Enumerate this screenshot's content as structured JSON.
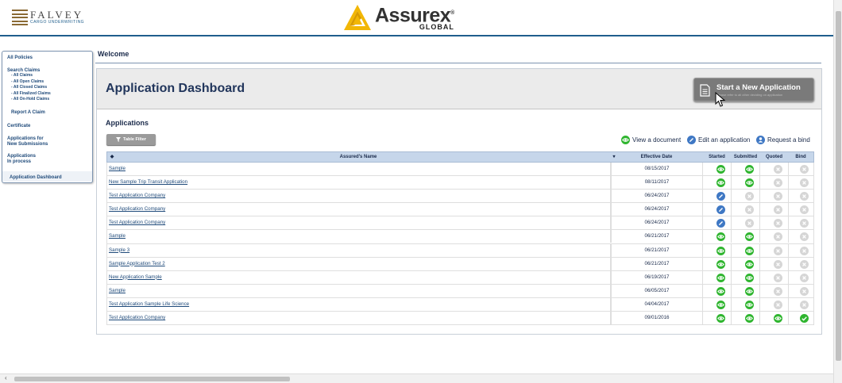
{
  "header": {
    "falvey_name": "FALVEY",
    "falvey_sub": "CARGO UNDERWRITING",
    "assurex_name": "Assurex",
    "assurex_reg": "®",
    "assurex_sub": "GLOBAL"
  },
  "sidebar": {
    "all_policies": "All Policies",
    "search_claims": "Search Claims",
    "claims": [
      "- All Claims",
      "- All Open Claims",
      "- All Closed Claims",
      "- All Finalized Claims",
      "- All On-Hold Claims"
    ],
    "report_claim": "Report A Claim",
    "certificate": "Certificate",
    "applications_new_1": "Applications for",
    "applications_new_2": "New Submissions",
    "applications_process_1": "Applications",
    "applications_process_2": "In process",
    "application_dashboard": "Application Dashboard"
  },
  "main": {
    "welcome": "Welcome",
    "dashboard_title": "Application Dashboard",
    "new_app_label": "Start a New Application",
    "new_app_sub": "Please refer to all other deciding on application",
    "applications_title": "Applications",
    "filter_label": "Table Filter",
    "legend": {
      "view": "View a document",
      "edit": "Edit an application",
      "request": "Request a bind"
    }
  },
  "colors": {
    "green": "#2fb52f",
    "blue": "#3f78c4",
    "gray": "#d6d6d6",
    "header_blue": "#c6d6ea",
    "accent": "#1f5e8c"
  },
  "table": {
    "columns": {
      "sort": "◆",
      "name": "Assured's Name",
      "sort2": "▾",
      "date": "Effective Date",
      "started": "Started",
      "submitted": "Submitted",
      "quoted": "Quoted",
      "bind": "Bind"
    },
    "rows": [
      {
        "name": "Sample",
        "date": "08/15/2017",
        "status": [
          "view",
          "view",
          "none",
          "none"
        ]
      },
      {
        "name": "New Sample Trip Transit Application",
        "date": "08/11/2017",
        "status": [
          "view",
          "view",
          "none",
          "none"
        ]
      },
      {
        "name": "Test Application Company",
        "date": "06/24/2017",
        "status": [
          "edit",
          "none",
          "none",
          "none"
        ]
      },
      {
        "name": "Test Application Company",
        "date": "06/24/2017",
        "status": [
          "edit",
          "none",
          "none",
          "none"
        ]
      },
      {
        "name": "Test Application Company",
        "date": "06/24/2017",
        "status": [
          "edit",
          "none",
          "none",
          "none"
        ]
      },
      {
        "name": "Sample",
        "date": "06/21/2017",
        "status": [
          "view",
          "view",
          "none",
          "none"
        ]
      },
      {
        "name": "Sample 3",
        "date": "06/21/2017",
        "status": [
          "view",
          "view",
          "none",
          "none"
        ]
      },
      {
        "name": "Sample Application Test 2",
        "date": "06/21/2017",
        "status": [
          "view",
          "view",
          "none",
          "none"
        ]
      },
      {
        "name": "New Application Sample",
        "date": "06/19/2017",
        "status": [
          "view",
          "view",
          "none",
          "none"
        ]
      },
      {
        "name": "Sample",
        "date": "06/05/2017",
        "status": [
          "view",
          "view",
          "none",
          "none"
        ]
      },
      {
        "name": "Test Application Sample Life Science",
        "date": "04/04/2017",
        "status": [
          "view",
          "view",
          "none",
          "none"
        ]
      },
      {
        "name": "Test Application Company",
        "date": "09/01/2016",
        "status": [
          "view",
          "view",
          "view",
          "check"
        ]
      }
    ]
  }
}
